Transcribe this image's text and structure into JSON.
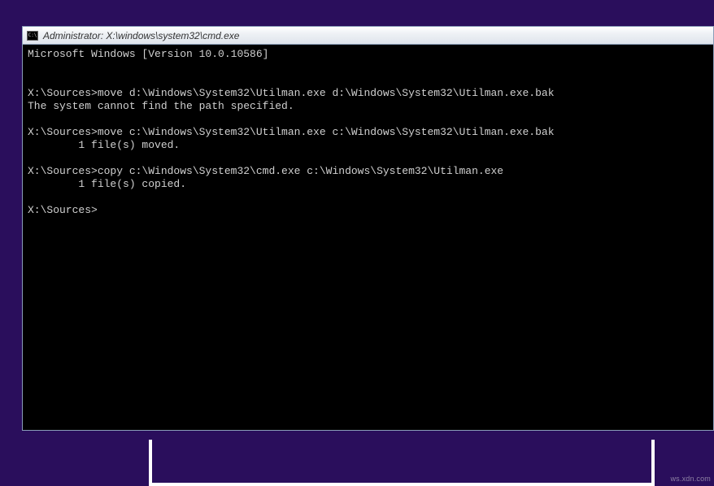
{
  "window": {
    "title": "Administrator: X:\\windows\\system32\\cmd.exe"
  },
  "console": {
    "lines": [
      "Microsoft Windows [Version 10.0.10586]",
      "",
      "",
      "X:\\Sources>move d:\\Windows\\System32\\Utilman.exe d:\\Windows\\System32\\Utilman.exe.bak",
      "The system cannot find the path specified.",
      "",
      "X:\\Sources>move c:\\Windows\\System32\\Utilman.exe c:\\Windows\\System32\\Utilman.exe.bak",
      "        1 file(s) moved.",
      "",
      "X:\\Sources>copy c:\\Windows\\System32\\cmd.exe c:\\Windows\\System32\\Utilman.exe",
      "        1 file(s) copied.",
      "",
      "X:\\Sources>"
    ]
  },
  "watermark": "ws.xdn.com"
}
